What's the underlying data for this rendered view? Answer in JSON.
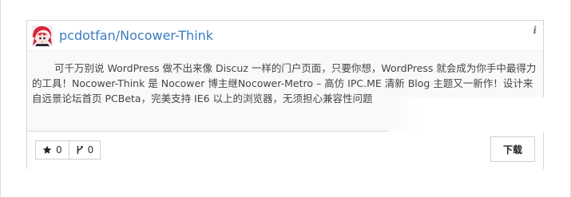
{
  "repo": {
    "owner": "pcdotfan",
    "separator": "/",
    "name": "Nocower-Think",
    "info_glyph": "i",
    "description": "可千万别说 WordPress 做不出来像 Discuz 一样的门户页面，只要你想，WordPress 就会成为你手中最得力的工具！Nocower-Think 是 Nocower 博主继Nocower-Metro – 高仿 IPC.ME 清新 Blog 主题又一新作！设计来自远景论坛首页 PCBeta，完美支持 IE6 以上的浏览器，无须担心兼容性问题"
  },
  "stats": {
    "stars": "0",
    "forks": "0"
  },
  "actions": {
    "download_label": "下载"
  },
  "colors": {
    "link": "#3b7bbf",
    "border": "#d6d6d6",
    "text": "#444444"
  },
  "icons": {
    "info": "info-icon",
    "star": "star-icon",
    "fork": "fork-icon",
    "avatar": "avatar"
  }
}
